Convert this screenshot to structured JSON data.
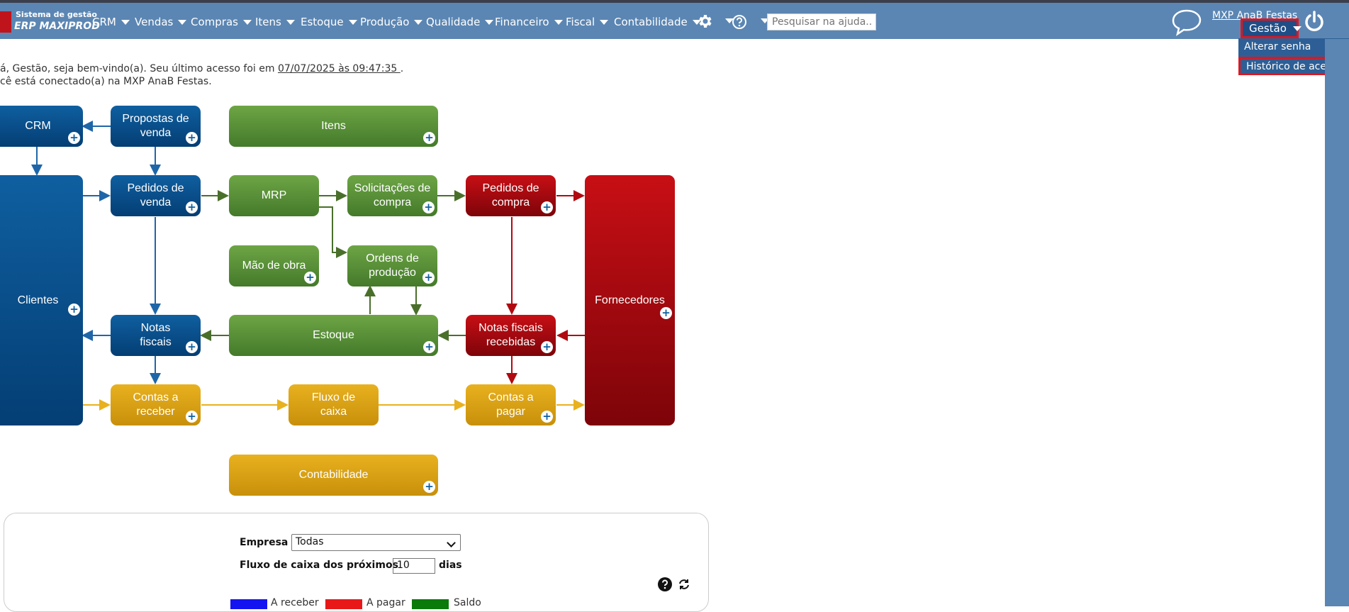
{
  "app": {
    "logo_line1": "Sistema de gestão",
    "logo_line2": "ERP MAXIPROD"
  },
  "menu": [
    {
      "label": "CRM"
    },
    {
      "label": "Vendas"
    },
    {
      "label": "Compras"
    },
    {
      "label": "Itens"
    },
    {
      "label": "Estoque"
    },
    {
      "label": "Produção"
    },
    {
      "label": "Qualidade"
    },
    {
      "label": "Financeiro"
    },
    {
      "label": "Fiscal"
    },
    {
      "label": "Contabilidade"
    }
  ],
  "icons": {
    "settings": "gear-icon",
    "help": "question-icon",
    "chat": "chat-bubble-icon",
    "power": "power-icon",
    "refresh": "refresh-icon"
  },
  "search": {
    "placeholder": "Pesquisar na ajuda..."
  },
  "header": {
    "company_link": "MXP AnaB Festas",
    "user_button": "Gestão"
  },
  "user_dropdown": {
    "items": [
      {
        "label": "Alterar senha"
      },
      {
        "label": "Histórico de acessos"
      }
    ]
  },
  "welcome": {
    "line1_prefix": "á, Gestão, seja bem-vindo(a). Seu último acesso foi em ",
    "last_access": "07/07/2025 às 09:47:35 ",
    "line1_suffix": ".",
    "line2": "cê está conectado(a) na MXP AnaB Festas."
  },
  "flow": {
    "crm": "CRM",
    "propostas": "Propostas de venda",
    "itens": "Itens",
    "clientes": "Clientes",
    "pedidos_venda": "Pedidos de venda",
    "mrp": "MRP",
    "solicitacoes": "Solicitações de compra",
    "pedidos_compra": "Pedidos de compra",
    "fornecedores": "Fornecedores",
    "mao_obra": "Mão de obra",
    "ordens": "Ordens de produção",
    "notas_fiscais": "Notas fiscais",
    "estoque": "Estoque",
    "notas_recebidas": "Notas fiscais recebidas",
    "contas_receber": "Contas a receber",
    "fluxo_caixa": "Fluxo de caixa",
    "contas_pagar": "Contas a pagar",
    "contabilidade": "Contabilidade"
  },
  "colors": {
    "topbar": "#5b86b3",
    "blue": "#0f5fa0",
    "green": "#5d9438",
    "red": "#b00a10",
    "gold": "#e0a814",
    "highlight": "#e3151d"
  },
  "cashflow": {
    "empresa_label": "Empresa",
    "empresa_value": "Todas",
    "days_label": "Fluxo de caixa dos próximos",
    "days_value": "10",
    "days_suffix": "dias",
    "legend": [
      {
        "label": "A receber",
        "color": "#1414f0"
      },
      {
        "label": "A pagar",
        "color": "#e81818"
      },
      {
        "label": "Saldo",
        "color": "#0a7a0a"
      }
    ]
  }
}
